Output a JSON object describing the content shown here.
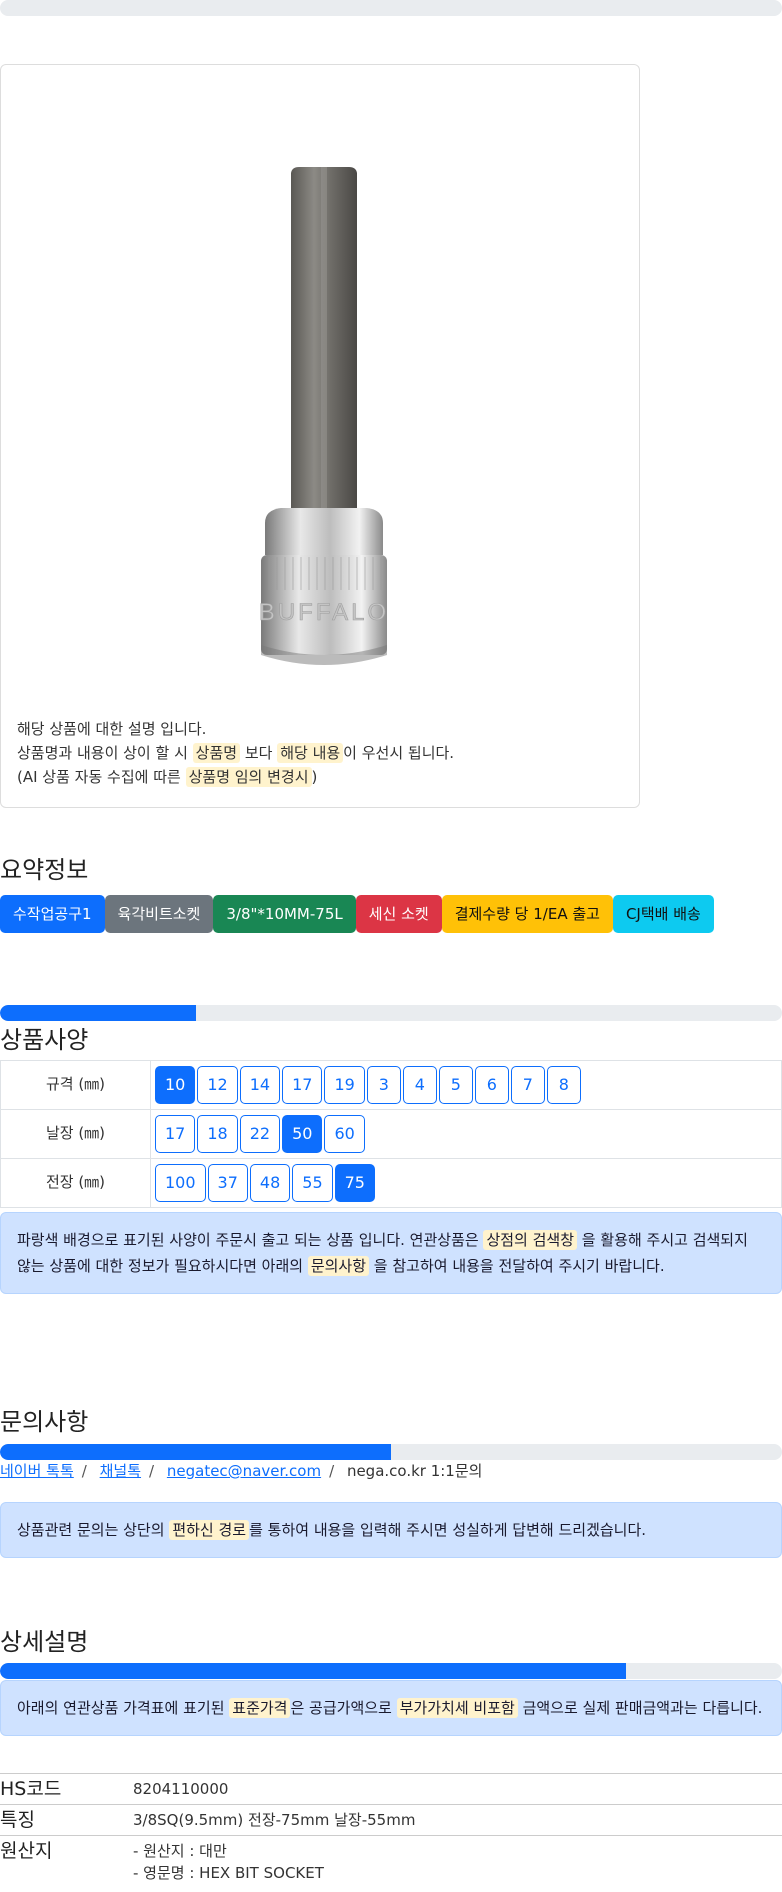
{
  "image_description": {
    "line1": "해당 상품에 대한 설명 입니다.",
    "line2_a": "상품명과 내용이 상이 할 시 ",
    "line2_hl1": "상품명",
    "line2_b": " 보다 ",
    "line2_hl2": "해당 내용",
    "line2_c": "이 우선시 됩니다.",
    "line3_a": "(AI 상품 자동 수집에 따른 ",
    "line3_hl": "상품명 임의 변경시",
    "line3_b": ")",
    "product_brand_text": "BUFFALO"
  },
  "summary": {
    "title": "요약정보",
    "badges": [
      {
        "label": "수작업공구1",
        "color": "#0d6efd"
      },
      {
        "label": "육각비트소켓",
        "color": "#6c757d"
      },
      {
        "label": "3/8\"*10MM-75L",
        "color": "#198754"
      },
      {
        "label": "세신 소켓",
        "color": "#dc3545"
      },
      {
        "label": "결제수량 당 1/EA 출고",
        "color": "#ffc107"
      },
      {
        "label": "CJ택배 배송",
        "color": "#0dcaf0"
      }
    ]
  },
  "specs": {
    "title": "상품사양",
    "progress": 0.25,
    "rows": [
      {
        "label": "규격 (㎜)",
        "options": [
          "10",
          "12",
          "14",
          "17",
          "19",
          "3",
          "4",
          "5",
          "6",
          "7",
          "8"
        ],
        "selected": "10"
      },
      {
        "label": "날장 (㎜)",
        "options": [
          "17",
          "18",
          "22",
          "50",
          "60"
        ],
        "selected": "50"
      },
      {
        "label": "전장 (㎜)",
        "options": [
          "100",
          "37",
          "48",
          "55",
          "75"
        ],
        "selected": "75"
      }
    ],
    "notice_a": "파랑색 배경으로 표기된 사양이 주문시 출고 되는 상품 입니다. 연관상품은 ",
    "notice_hl1": "상점의 검색창",
    "notice_b": " 을 활용해 주시고 검색되지 않는 상품에 대한 정보가 필요하시다면 아래의 ",
    "notice_hl2": "문의사항",
    "notice_c": " 을 참고하여 내용을 전달하여 주시기 바랍니다."
  },
  "inquiry": {
    "title": "문의사항",
    "progress": 0.5,
    "links": [
      "네이버 톡톡",
      "채널톡",
      "negatec@naver.com"
    ],
    "plain": "nega.co.kr 1:1문의",
    "notice_a": "상품관련 문의는 상단의 ",
    "notice_hl": "편하신 경로",
    "notice_b": "를 통하여 내용을 입력해 주시면 성실하게 답변해 드리겠습니다."
  },
  "detail": {
    "title": "상세설명",
    "progress": 0.8,
    "notice_a": "아래의 연관상품 가격표에 표기된 ",
    "notice_hl1": "표준가격",
    "notice_b": "은 공급가액으로 ",
    "notice_hl2": "부가가치세 비포함",
    "notice_c": " 금액으로 실제 판매금액과는 다릅니다."
  },
  "info": {
    "hs_label": "HS코드",
    "hs_value": "8204110000",
    "feature_label": "특징",
    "feature_value": "3/8SQ(9.5mm) 전장-75mm 날장-55mm",
    "origin_label": "원산지",
    "origin_line1": "- 원산지 : 대만",
    "origin_line2": "- 영문명 : HEX BIT SOCKET"
  }
}
